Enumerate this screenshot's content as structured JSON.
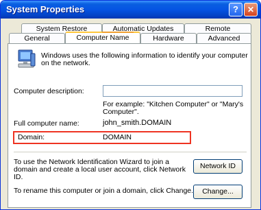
{
  "window": {
    "title": "System Properties"
  },
  "tabs": {
    "row1": [
      "System Restore",
      "Automatic Updates",
      "Remote"
    ],
    "row2": [
      "General",
      "Computer Name",
      "Hardware",
      "Advanced"
    ],
    "active": "Computer Name"
  },
  "panel": {
    "intro": [
      "Windows uses the following information to identify your computer",
      "on the network."
    ],
    "description_label": "Computer description:",
    "description_value": "",
    "example": [
      "For example: \"Kitchen Computer\" or \"Mary's",
      "Computer\"."
    ],
    "full_name_label": "Full computer name:",
    "full_name_value": "john_smith.DOMAIN",
    "domain_label": "Domain:",
    "domain_value": "DOMAIN",
    "wizard_text": [
      "To use the Network Identification Wizard to join a",
      "domain and create a local user account, click Network",
      "ID."
    ],
    "network_id_button": "Network ID",
    "rename_text": "To rename this computer or join a domain, click Change.",
    "change_button": "Change..."
  }
}
